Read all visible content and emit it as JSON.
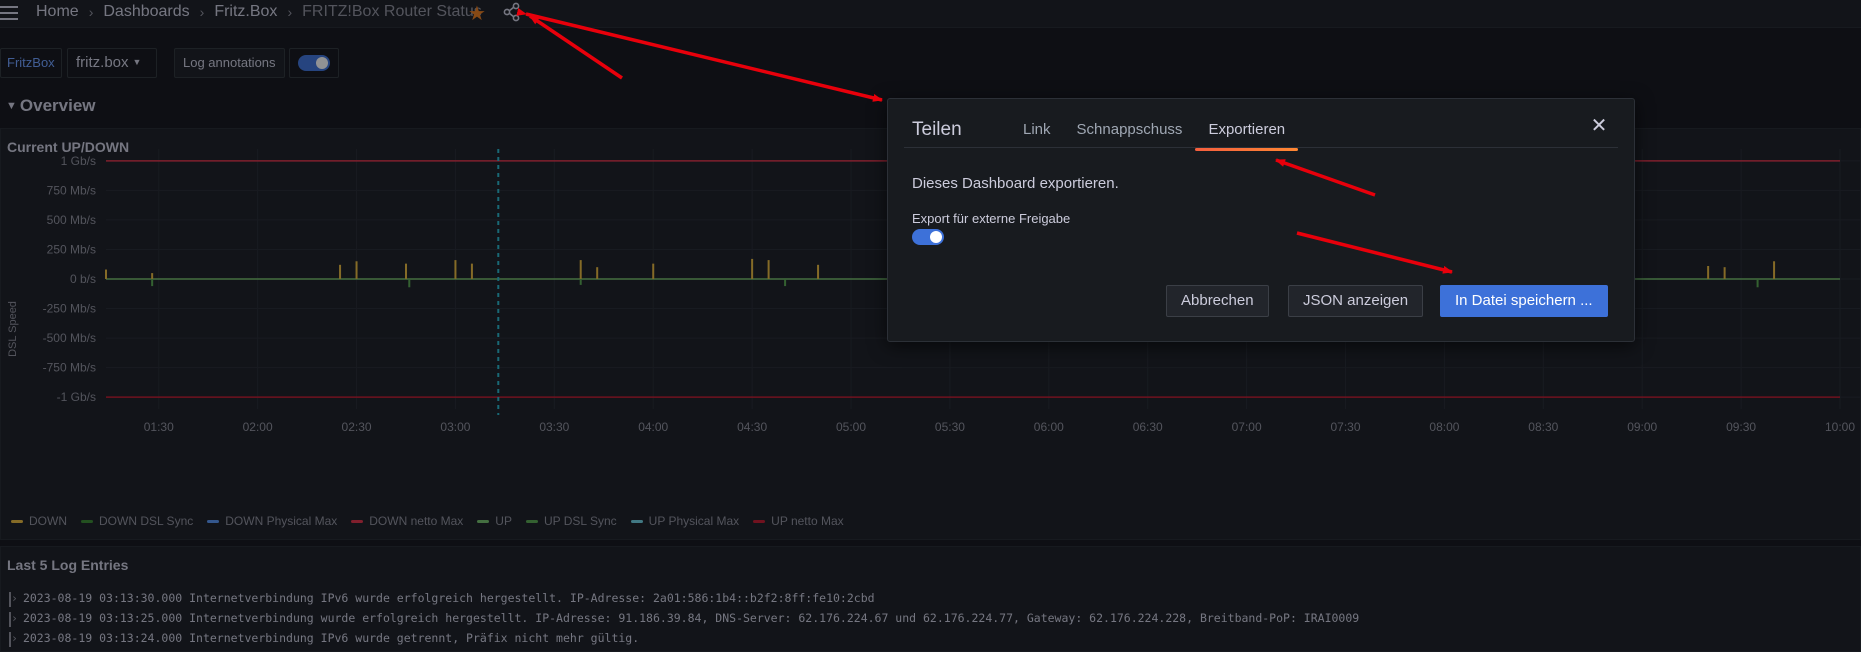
{
  "topbar": {
    "breadcrumb": [
      "Home",
      "Dashboards",
      "Fritz.Box",
      "FRITZ!Box Router Status"
    ]
  },
  "controls": {
    "variable_label": "FritzBox",
    "variable_value": "fritz.box",
    "annotations_label": "Log annotations",
    "annotations_enabled": true
  },
  "row": {
    "title": "Overview"
  },
  "graph_panel": {
    "title": "Current UP/DOWN",
    "ylabel": "DSL Speed",
    "legend": [
      {
        "name": "DOWN",
        "color": "#eab839"
      },
      {
        "name": "DOWN DSL Sync",
        "color": "#37872d"
      },
      {
        "name": "DOWN Physical Max",
        "color": "#5794f2"
      },
      {
        "name": "DOWN netto Max",
        "color": "#e02f44"
      },
      {
        "name": "UP",
        "color": "#73bf69"
      },
      {
        "name": "UP DSL Sync",
        "color": "#56a64b"
      },
      {
        "name": "UP Physical Max",
        "color": "#6ed0e0"
      },
      {
        "name": "UP netto Max",
        "color": "#c4162a"
      }
    ]
  },
  "chart_data": {
    "type": "line",
    "title": "Current UP/DOWN",
    "xlabel": "",
    "ylabel": "DSL Speed",
    "y_ticks": [
      "1 Gb/s",
      "750 Mb/s",
      "500 Mb/s",
      "250 Mb/s",
      "0 b/s",
      "-250 Mb/s",
      "-500 Mb/s",
      "-750 Mb/s",
      "-1 Gb/s"
    ],
    "y_tick_values_mbps": [
      1000,
      750,
      500,
      250,
      0,
      -250,
      -500,
      -750,
      -1000
    ],
    "ylim_mbps": [
      -1100,
      1100
    ],
    "x_ticks": [
      "01:30",
      "02:00",
      "02:30",
      "03:00",
      "03:30",
      "04:00",
      "04:30",
      "05:00",
      "05:30",
      "06:00",
      "06:30",
      "07:00",
      "07:30",
      "08:00",
      "08:30",
      "09:00",
      "09:30",
      "10:00"
    ],
    "xlim": [
      "01:14",
      "10:00"
    ],
    "legend_position": "bottom",
    "series": [
      {
        "name": "DOWN netto Max",
        "x": [
          "01:14",
          "10:00"
        ],
        "y": [
          1000,
          1000
        ]
      },
      {
        "name": "UP netto Max",
        "x": [
          "01:14",
          "10:00"
        ],
        "y": [
          -1000,
          -1000
        ]
      },
      {
        "name": "UP",
        "x": [
          "01:14",
          "10:00"
        ],
        "y": [
          0,
          0
        ]
      },
      {
        "name": "DOWN",
        "x": [
          "01:14",
          "01:28",
          "02:25",
          "02:30",
          "02:45",
          "03:00",
          "03:05",
          "03:38",
          "03:43",
          "04:00",
          "04:30",
          "04:35",
          "04:50",
          "09:20",
          "09:25",
          "09:40"
        ],
        "y": [
          80,
          50,
          120,
          150,
          130,
          160,
          130,
          160,
          100,
          130,
          170,
          160,
          120,
          110,
          100,
          150
        ]
      },
      {
        "name": "UP DSL Sync",
        "x": [
          "01:28",
          "02:46",
          "03:38",
          "04:40",
          "09:35"
        ],
        "y": [
          -60,
          -70,
          -50,
          -60,
          -70
        ]
      }
    ],
    "annotation_time": "03:13"
  },
  "logs_panel": {
    "title": "Last 5 Log Entries",
    "entries": [
      "2023-08-19 03:13:30.000 Internetverbindung IPv6 wurde erfolgreich hergestellt. IP-Adresse: 2a01:586:1b4::b2f2:8ff:fe10:2cbd",
      "2023-08-19 03:13:25.000 Internetverbindung wurde erfolgreich hergestellt. IP-Adresse: 91.186.39.84, DNS-Server: 62.176.224.67 und 62.176.224.77, Gateway: 62.176.224.228, Breitband-PoP: IRAI0009",
      "2023-08-19 03:13:24.000 Internetverbindung IPv6 wurde getrennt, Präfix nicht mehr gültig."
    ]
  },
  "modal": {
    "title": "Teilen",
    "tabs": [
      "Link",
      "Schnappschuss",
      "Exportieren"
    ],
    "active_tab": "Exportieren",
    "description": "Dieses Dashboard exportieren.",
    "external_label": "Export für externe Freigabe",
    "external_enabled": true,
    "cancel_label": "Abbrechen",
    "json_label": "JSON anzeigen",
    "save_label": "In Datei speichern ..."
  },
  "colors": {
    "accent_blue": "#3d71d9",
    "tab_underline": "#ff8833",
    "favorite_star": "#eb7b18",
    "arrow_red": "#e8000b"
  },
  "icons": [
    "menu-icon",
    "chevron-right-icon",
    "star-icon",
    "share-icon",
    "chevron-down-icon",
    "close-icon"
  ]
}
